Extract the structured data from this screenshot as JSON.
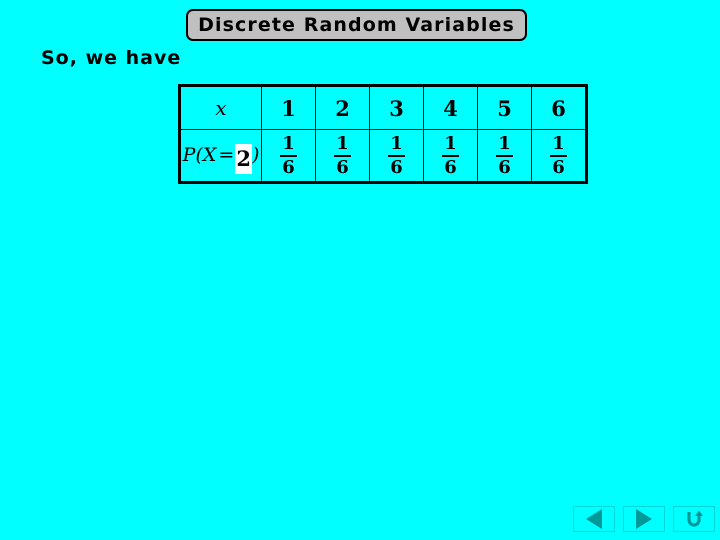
{
  "slide": {
    "background_color": "#00ffff",
    "title": "Discrete Random Variables",
    "lead_text": "So, we have"
  },
  "table": {
    "row_head_label": "x",
    "row_prob_label_parts": {
      "p": "P",
      "open_paren": "(",
      "variable": "X",
      "equals": "=",
      "value": "2",
      "close_paren": ")"
    },
    "row_prob_label_full": "P(X = 2)",
    "columns": [
      "1",
      "2",
      "3",
      "4",
      "5",
      "6"
    ],
    "probabilities": [
      {
        "numerator": "1",
        "denominator": "6"
      },
      {
        "numerator": "1",
        "denominator": "6"
      },
      {
        "numerator": "1",
        "denominator": "6"
      },
      {
        "numerator": "1",
        "denominator": "6"
      },
      {
        "numerator": "1",
        "denominator": "6"
      },
      {
        "numerator": "1",
        "denominator": "6"
      }
    ],
    "highlighted_column_index": 1,
    "highlight_color": "#ffffff",
    "cell_color": "#00ffff",
    "border_color": "#000000"
  },
  "navigation": {
    "buttons": [
      {
        "name": "previous-slide-button",
        "icon": "triangle-left-icon",
        "label": ""
      },
      {
        "name": "next-slide-button",
        "icon": "triangle-right-icon",
        "label": ""
      },
      {
        "name": "return-slide-button",
        "icon": "u-turn-arrow-icon",
        "label": ""
      }
    ],
    "accent_color": "#009999"
  }
}
